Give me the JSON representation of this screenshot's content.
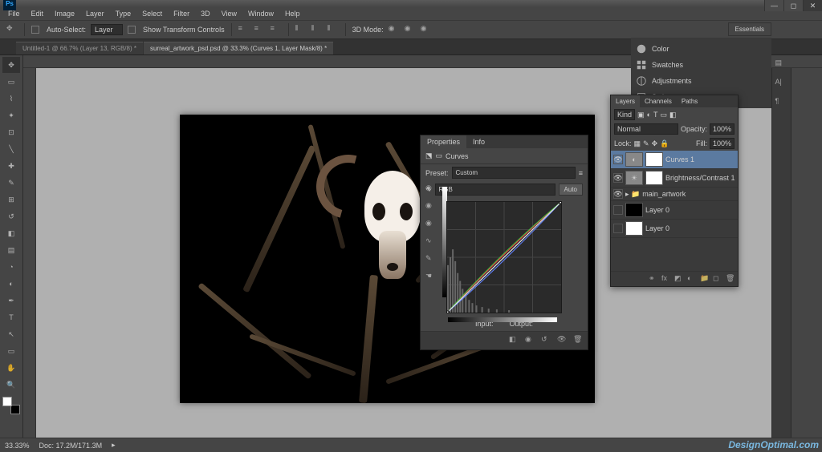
{
  "app": {
    "logo": "Ps"
  },
  "menu": [
    "File",
    "Edit",
    "Image",
    "Layer",
    "Type",
    "Select",
    "Filter",
    "3D",
    "View",
    "Window",
    "Help"
  ],
  "options": {
    "auto_select": "Auto-Select:",
    "auto_select_value": "Layer",
    "show_transform": "Show Transform Controls",
    "mode_3d": "3D Mode:"
  },
  "tabs": [
    "Untitled-1 @ 66.7% (Layer 13, RGB/8) *",
    "surreal_artwork_psd.psd @ 33.3% (Curves 1, Layer Mask/8) *"
  ],
  "essentials": "Essentials",
  "right_panels": [
    "Color",
    "Swatches",
    "Adjustments",
    "Styles"
  ],
  "properties": {
    "tabs": [
      "Properties",
      "Info"
    ],
    "type": "Curves",
    "preset_label": "Preset:",
    "preset_value": "Custom",
    "channel_value": "RGB",
    "auto": "Auto",
    "input_label": "Input:",
    "output_label": "Output:"
  },
  "layers": {
    "tabs": [
      "Layers",
      "Channels",
      "Paths"
    ],
    "kind": "Kind",
    "blend": "Normal",
    "opacity_label": "Opacity:",
    "opacity_value": "100%",
    "lock_label": "Lock:",
    "fill_label": "Fill:",
    "fill_value": "100%",
    "items": [
      {
        "name": "Curves 1",
        "sel": true,
        "adj": true
      },
      {
        "name": "Brightness/Contrast 1",
        "adj": true
      },
      {
        "name": "main_artwork",
        "folder": true
      },
      {
        "name": "Layer 0",
        "blk": true
      },
      {
        "name": "Layer 0",
        "blk": false
      }
    ]
  },
  "status": {
    "zoom": "33.33%",
    "doc": "Doc: 17.2M/171.3M"
  },
  "watermark": "DesignOptimal.com",
  "chart_data": {
    "type": "line",
    "title": "Curves",
    "xlabel": "Input",
    "ylabel": "Output",
    "xlim": [
      0,
      255
    ],
    "ylim": [
      0,
      255
    ],
    "series": [
      {
        "name": "R",
        "color": "#ff4040",
        "values": [
          [
            0,
            0
          ],
          [
            255,
            255
          ]
        ]
      },
      {
        "name": "G",
        "color": "#40c040",
        "values": [
          [
            0,
            0
          ],
          [
            128,
            140
          ],
          [
            255,
            255
          ]
        ]
      },
      {
        "name": "B",
        "color": "#6080ff",
        "values": [
          [
            0,
            0
          ],
          [
            128,
            115
          ],
          [
            255,
            255
          ]
        ]
      },
      {
        "name": "RGB",
        "color": "#e0e0e0",
        "values": [
          [
            0,
            0
          ],
          [
            255,
            255
          ]
        ]
      }
    ],
    "histogram": "dark-heavy"
  }
}
